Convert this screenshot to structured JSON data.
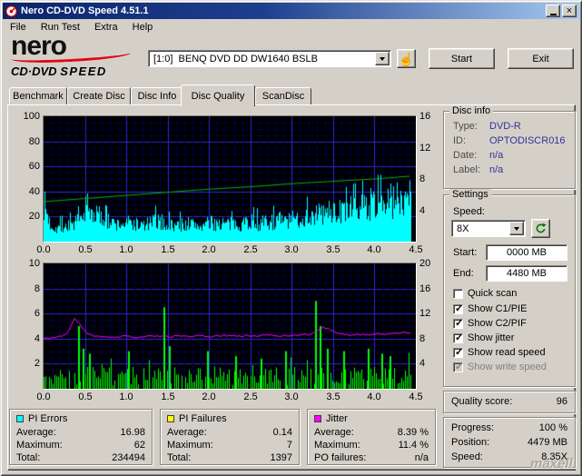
{
  "window": {
    "title": "Nero CD-DVD Speed 4.51.1"
  },
  "menu": {
    "items": [
      "File",
      "Run Test",
      "Extra",
      "Help"
    ]
  },
  "logo": {
    "name": "nero",
    "product_a": "CD·DVD",
    "product_b": "SPEED"
  },
  "toolbar": {
    "drive_selector": "[1:0]  BENQ DVD DD DW1640 BSLB",
    "start_label": "Start",
    "exit_label": "Exit"
  },
  "tabs": [
    {
      "label": "Benchmark",
      "selected": false
    },
    {
      "label": "Create Disc",
      "selected": false
    },
    {
      "label": "Disc Info",
      "selected": false
    },
    {
      "label": "Disc Quality",
      "selected": true
    },
    {
      "label": "ScanDisc",
      "selected": false
    }
  ],
  "disc_info": {
    "title": "Disc info",
    "rows": [
      {
        "label": "Type:",
        "value": "DVD-R"
      },
      {
        "label": "ID:",
        "value": "OPTODISCR016"
      },
      {
        "label": "Date:",
        "value": "n/a"
      },
      {
        "label": "Label:",
        "value": "n/a"
      }
    ]
  },
  "settings": {
    "title": "Settings",
    "speed_label": "Speed:",
    "speed_value": "8X",
    "start_label": "Start:",
    "start_value": "0000 MB",
    "end_label": "End:",
    "end_value": "4480 MB",
    "checkboxes": [
      {
        "label": "Quick scan",
        "checked": false,
        "disabled": false
      },
      {
        "label": "Show C1/PIE",
        "checked": true,
        "disabled": false
      },
      {
        "label": "Show C2/PIF",
        "checked": true,
        "disabled": false
      },
      {
        "label": "Show jitter",
        "checked": true,
        "disabled": false
      },
      {
        "label": "Show read speed",
        "checked": true,
        "disabled": false
      },
      {
        "label": "Show write speed",
        "checked": true,
        "disabled": true
      }
    ]
  },
  "quality": {
    "label": "Quality score:",
    "value": "96"
  },
  "progress": {
    "rows": [
      {
        "label": "Progress:",
        "value": "100 %"
      },
      {
        "label": "Position:",
        "value": "4479 MB"
      },
      {
        "label": "Speed:",
        "value": "8.35X"
      }
    ]
  },
  "legend_panels": [
    {
      "title": "PI Errors",
      "color": "#00ffff",
      "rows": [
        [
          "Average:",
          "16.98"
        ],
        [
          "Maximum:",
          "62"
        ],
        [
          "Total:",
          "234494"
        ]
      ]
    },
    {
      "title": "PI Failures",
      "color": "#ffff00",
      "rows": [
        [
          "Average:",
          "0.14"
        ],
        [
          "Maximum:",
          "7"
        ],
        [
          "Total:",
          "1397"
        ]
      ]
    },
    {
      "title": "Jitter",
      "color": "#ff00ff",
      "rows": [
        [
          "Average:",
          "8.39 %"
        ],
        [
          "Maximum:",
          "11.4 %"
        ],
        [
          "PO failures:",
          "n/a"
        ]
      ]
    }
  ],
  "watermark": "maxell",
  "chart_data": [
    {
      "type": "area",
      "title": "PI Errors vs disc position (GB)",
      "x_range": [
        0,
        4.5
      ],
      "x_ticks": [
        "0.0",
        "0.5",
        "1.0",
        "1.5",
        "2.0",
        "2.5",
        "3.0",
        "3.5",
        "4.0",
        "4.5"
      ],
      "y_left_range": [
        0,
        100
      ],
      "y_left_ticks": [
        "100",
        "80",
        "60",
        "40",
        "20"
      ],
      "y_right_range": [
        0,
        16
      ],
      "y_right_ticks": [
        "16",
        "12",
        "8",
        "4"
      ],
      "grid": true,
      "background": "#000000",
      "series": [
        {
          "name": "PI Errors",
          "type": "area",
          "color": "#00ffff",
          "axis": "left",
          "x_end": 4.43,
          "average": 16.98,
          "maximum": 62,
          "total": 234494,
          "envelope": [
            34,
            15,
            12,
            13,
            14,
            16,
            19,
            24,
            26,
            22,
            18,
            16,
            15,
            16,
            17,
            15,
            14,
            16,
            18,
            17,
            15,
            14,
            15,
            16,
            15,
            14,
            15,
            16,
            17,
            16,
            15,
            16,
            17,
            18,
            17,
            16,
            17,
            18,
            19,
            18,
            19,
            20,
            22,
            23,
            24,
            25,
            26,
            27,
            26,
            28,
            29,
            30,
            32,
            34,
            33,
            35,
            36,
            38,
            40,
            52
          ]
        },
        {
          "name": "Read speed (X)",
          "type": "line",
          "color": "#00b400",
          "axis": "right",
          "x": [
            0,
            0.5,
            1.0,
            1.5,
            2.0,
            2.5,
            3.0,
            3.5,
            4.0,
            4.43
          ],
          "values": [
            5.1,
            5.5,
            5.9,
            6.3,
            6.7,
            7.0,
            7.4,
            7.7,
            8.0,
            8.35
          ]
        }
      ]
    },
    {
      "type": "bars+line",
      "title": "PI Failures and Jitter vs disc position (GB)",
      "x_range": [
        0,
        4.5
      ],
      "x_ticks": [
        "0.0",
        "0.5",
        "1.0",
        "1.5",
        "2.0",
        "2.5",
        "3.0",
        "3.5",
        "4.0",
        "4.5"
      ],
      "y_left_range": [
        0,
        10
      ],
      "y_left_ticks": [
        "10",
        "8",
        "6",
        "4",
        "2"
      ],
      "y_right_range": [
        0,
        20
      ],
      "y_right_ticks": [
        "20",
        "16",
        "12",
        "8",
        "4"
      ],
      "grid": true,
      "background": "#000000",
      "series": [
        {
          "name": "PI Failures",
          "type": "bars",
          "color": "#00ff00",
          "axis": "left",
          "x_end": 4.43,
          "average": 0.14,
          "maximum": 7,
          "total": 1397,
          "base_level": 2,
          "spikes": [
            [
              0.42,
              5
            ],
            [
              0.47,
              3.2
            ],
            [
              0.55,
              2.8
            ],
            [
              1.02,
              3
            ],
            [
              1.45,
              6.5
            ],
            [
              1.52,
              3.4
            ],
            [
              1.98,
              3
            ],
            [
              2.32,
              2.6
            ],
            [
              2.62,
              2.4
            ],
            [
              2.92,
              3
            ],
            [
              3.28,
              7
            ],
            [
              3.34,
              5
            ],
            [
              3.42,
              3.2
            ],
            [
              3.62,
              3
            ],
            [
              3.92,
              3.2
            ],
            [
              4.08,
              2.8
            ],
            [
              4.18,
              2.6
            ]
          ]
        },
        {
          "name": "Jitter (%)",
          "type": "line",
          "color": "#ff00ff",
          "axis": "right",
          "x_end": 4.43,
          "average": 8.39,
          "maximum": 11.4,
          "values": [
            8.0,
            8.1,
            8.2,
            8.4,
            9.0,
            11.4,
            10.0,
            8.8,
            8.4,
            8.3,
            8.2,
            8.3,
            8.2,
            8.4,
            8.3,
            8.2,
            8.3,
            8.4,
            8.3,
            8.4,
            8.3,
            8.4,
            8.4,
            8.3,
            8.4,
            8.5,
            8.4,
            8.3,
            8.4,
            8.5,
            8.4,
            8.5,
            8.4,
            8.5,
            8.4,
            8.5,
            8.6,
            8.5,
            8.4,
            8.5,
            8.5,
            8.6,
            8.7,
            8.6,
            9.3,
            9.8,
            9.5,
            9.0,
            8.7,
            8.6,
            8.6,
            8.7,
            8.6,
            8.7,
            8.8,
            8.7,
            8.8,
            8.9,
            9.0,
            8.8
          ]
        }
      ]
    }
  ]
}
